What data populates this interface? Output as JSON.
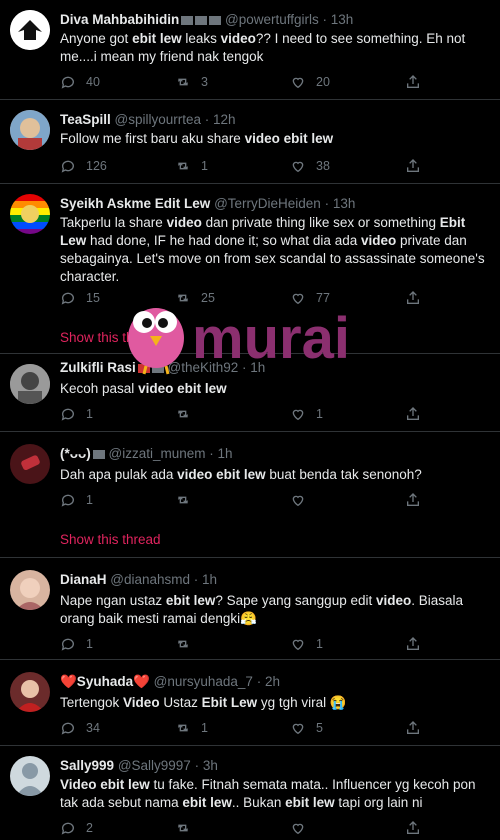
{
  "tweets": [
    {
      "name": "Diva Mahbabihidin",
      "handle": "@powertuffgirls",
      "time": "13h",
      "text_parts": [
        [
          "Anyone got ",
          false
        ],
        [
          "ebit lew",
          true
        ],
        [
          " leaks ",
          false
        ],
        [
          "video",
          true
        ],
        [
          "?? I need to see something. Eh not me....i mean my friend nak tengok",
          false
        ]
      ],
      "replies": "40",
      "retweets": "3",
      "likes": "20"
    },
    {
      "name": "TeaSpill",
      "handle": "@spillyourrtea",
      "time": "12h",
      "text_parts": [
        [
          "Follow me first baru aku share ",
          false
        ],
        [
          "video ebit lew",
          true
        ]
      ],
      "replies": "126",
      "retweets": "1",
      "likes": "38"
    },
    {
      "name": "Syeikh Askme Edit Lew",
      "handle": "@TerryDieHeiden",
      "time": "13h",
      "text_parts": [
        [
          "Takperlu la share ",
          false
        ],
        [
          "video",
          true
        ],
        [
          " dan private thing like sex or something ",
          false
        ],
        [
          "Ebit Lew",
          true
        ],
        [
          " had done, IF he had done it; so what dia ada ",
          false
        ],
        [
          "video",
          true
        ],
        [
          " private dan sebagainya. Let's move on from sex scandal to assassinate someone's character.",
          false
        ]
      ],
      "replies": "15",
      "retweets": "25",
      "likes": "77",
      "thread": "Show this thread"
    },
    {
      "name": "Zulkifli Rasi",
      "handle": "@theKith92",
      "time": "1h",
      "text_parts": [
        [
          "Kecoh pasal ",
          false
        ],
        [
          "video ebit lew",
          true
        ]
      ],
      "replies": "1",
      "retweets": "",
      "likes": "1"
    },
    {
      "name": "(*ᴗᴗ)",
      "handle": "@izzati_munem",
      "time": "1h",
      "text_parts": [
        [
          "Dah apa pulak ada ",
          false
        ],
        [
          "video ebit lew",
          true
        ],
        [
          " buat benda tak senonoh?",
          false
        ]
      ],
      "replies": "1",
      "retweets": "",
      "likes": "",
      "thread": "Show this thread"
    },
    {
      "name": "DianaH",
      "handle": "@dianahsmd",
      "time": "1h",
      "text_parts": [
        [
          "Nape ngan ustaz ",
          false
        ],
        [
          "ebit lew",
          true
        ],
        [
          "? Sape yang sanggup edit ",
          false
        ],
        [
          "video",
          true
        ],
        [
          ". Biasala orang baik mesti ramai dengki😤",
          false
        ]
      ],
      "replies": "1",
      "retweets": "",
      "likes": "1"
    },
    {
      "name": "❤️Syuhada❤️",
      "handle": "@nursyuhada_7",
      "time": "2h",
      "text_parts": [
        [
          "Tertengok ",
          false
        ],
        [
          "Video",
          true
        ],
        [
          " Ustaz ",
          false
        ],
        [
          "Ebit Lew",
          true
        ],
        [
          " yg tgh viral 😭",
          false
        ]
      ],
      "replies": "34",
      "retweets": "1",
      "likes": "5"
    },
    {
      "name": "Sally999",
      "handle": "@Sally9997",
      "time": "3h",
      "text_parts": [
        [
          "Video ebit lew",
          true
        ],
        [
          " tu fake. Fitnah semata mata.. Influencer yg kecoh pon tak ada sebut nama ",
          false
        ],
        [
          "ebit lew",
          true
        ],
        [
          ".. Bukan ",
          false
        ],
        [
          "ebit lew",
          true
        ],
        [
          " tapi org lain ni",
          false
        ]
      ],
      "replies": "2",
      "retweets": "",
      "likes": ""
    }
  ],
  "watermark": {
    "text": "murai",
    "color": "#8b2f6f"
  },
  "colors": {
    "bg": "#000000",
    "link": "#e0245e",
    "muted": "#6e767d",
    "text": "#e7e9ea",
    "divider": "#2f3336"
  }
}
